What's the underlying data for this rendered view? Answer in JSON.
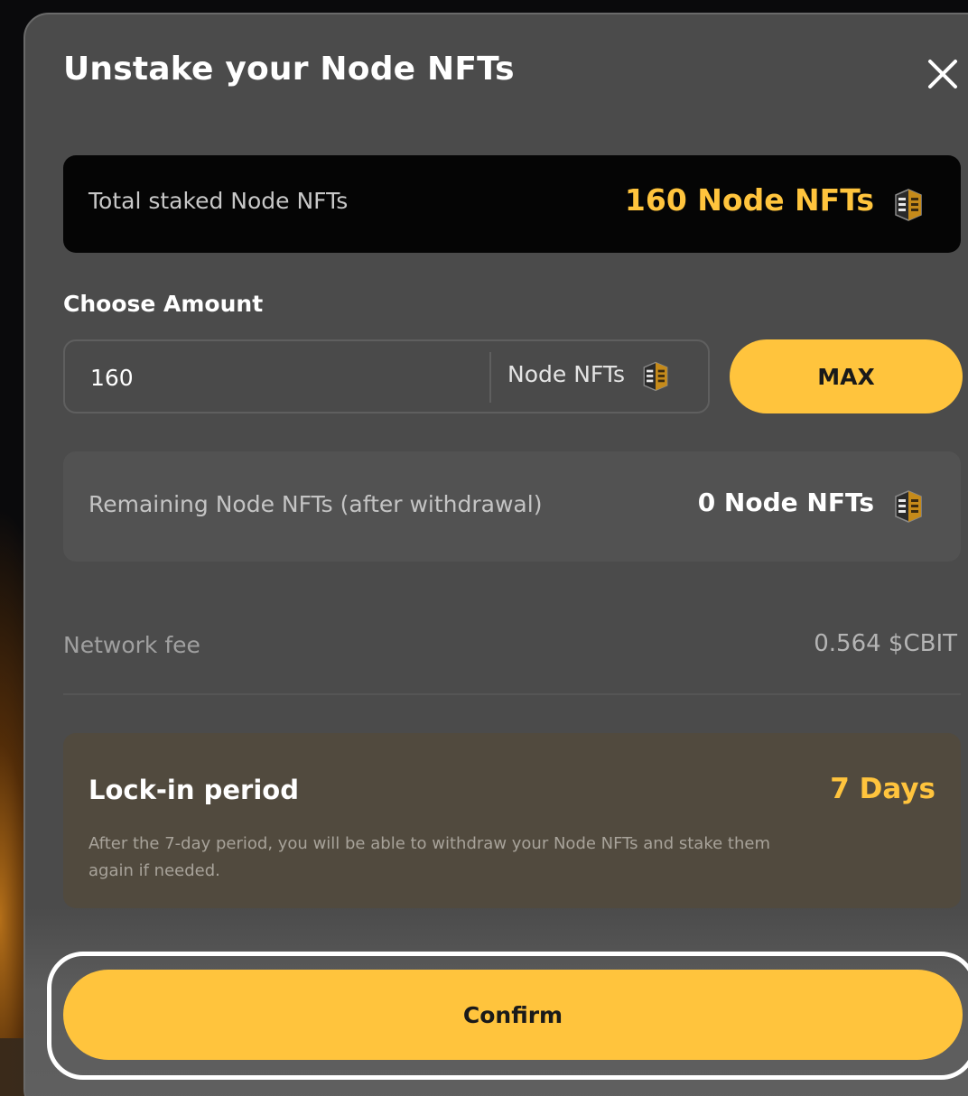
{
  "modal": {
    "title": "Unstake your Node NFTs",
    "close_icon": "close-icon"
  },
  "total": {
    "label": "Total staked Node NFTs",
    "value": "160 Node NFTs",
    "icon": "node-nft-icon"
  },
  "amount": {
    "label": "Choose Amount",
    "value": "160",
    "unit": "Node NFTs",
    "max_label": "MAX"
  },
  "remaining": {
    "label": "Remaining Node NFTs (after withdrawal)",
    "value": "0 Node NFTs"
  },
  "fee": {
    "label": "Network fee",
    "value": "0.564 $CBIT"
  },
  "lock": {
    "title": "Lock-in period",
    "value": "7 Days",
    "description": "After the 7-day period, you will be able to withdraw your Node NFTs and stake them again if needed."
  },
  "confirm_label": "Confirm",
  "colors": {
    "accent": "#ffc43d",
    "modal_bg": "#4b4b4b",
    "dark_box": "#050505"
  }
}
